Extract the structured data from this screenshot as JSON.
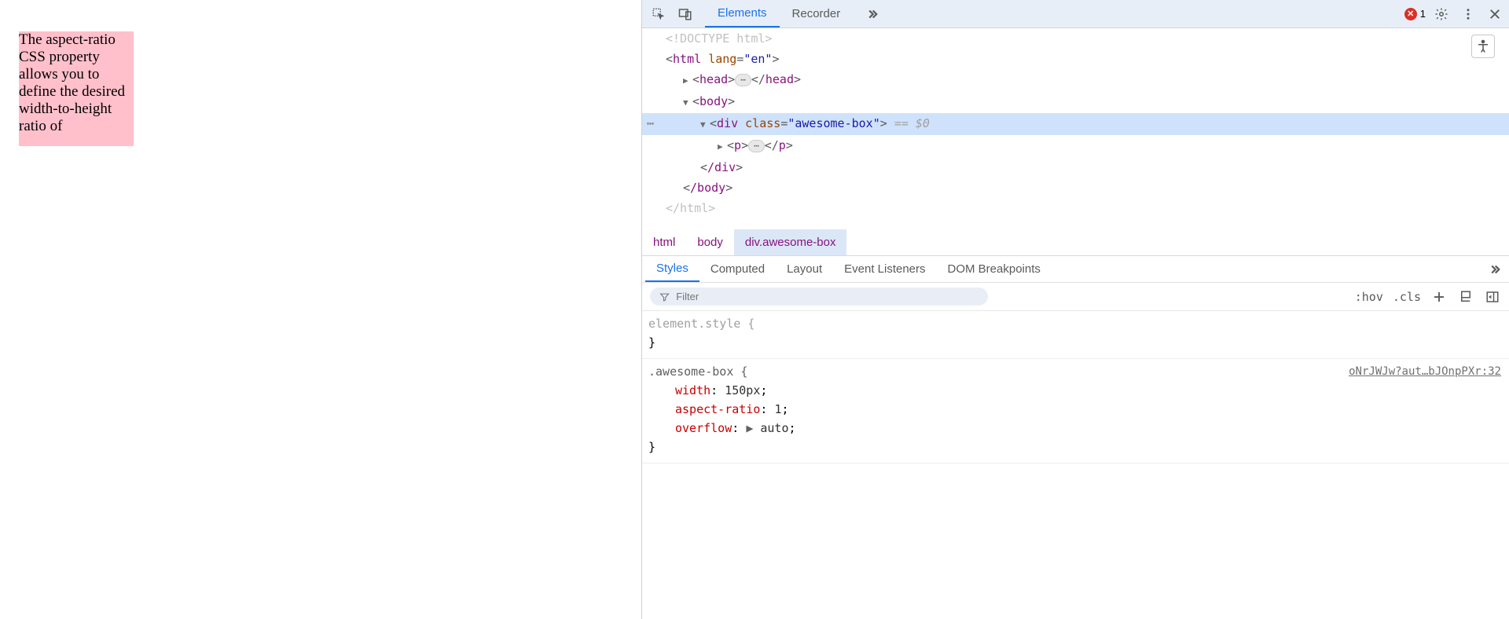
{
  "page": {
    "box_text": "The aspect-ratio CSS property allows you to define the desired width-to-height ratio of"
  },
  "toolbar": {
    "tabs": [
      "Elements",
      "Recorder"
    ],
    "error_count": "1"
  },
  "dom": {
    "doctype": "<!DOCTYPE html>",
    "html_open": "html",
    "html_lang_attr": "lang",
    "html_lang_val": "\"en\"",
    "head": "head",
    "body": "body",
    "div": "div",
    "div_class_attr": "class",
    "div_class_val": "\"awesome-box\"",
    "eq0": "== $0",
    "p": "p",
    "div_close": "/div",
    "body_close": "/body",
    "html_close": "</html>"
  },
  "breadcrumb": {
    "c1": "html",
    "c2": "body",
    "c3": "div.awesome-box"
  },
  "styles_tabs": {
    "t1": "Styles",
    "t2": "Computed",
    "t3": "Layout",
    "t4": "Event Listeners",
    "t5": "DOM Breakpoints"
  },
  "filter": {
    "placeholder": "Filter",
    "hov": ":hov",
    "cls": ".cls"
  },
  "rules": {
    "element_style": "element.style",
    "brace_open": " {",
    "brace_close": "}",
    "r1_selector": ".awesome-box",
    "r1_source": "oNrJWJw?aut…bJOnpPXr:32",
    "r1_p1_name": "width",
    "r1_p1_val": "150px",
    "r1_p2_name": "aspect-ratio",
    "r1_p2_val": "1",
    "r1_p3_name": "overflow",
    "r1_p3_val": "auto"
  }
}
